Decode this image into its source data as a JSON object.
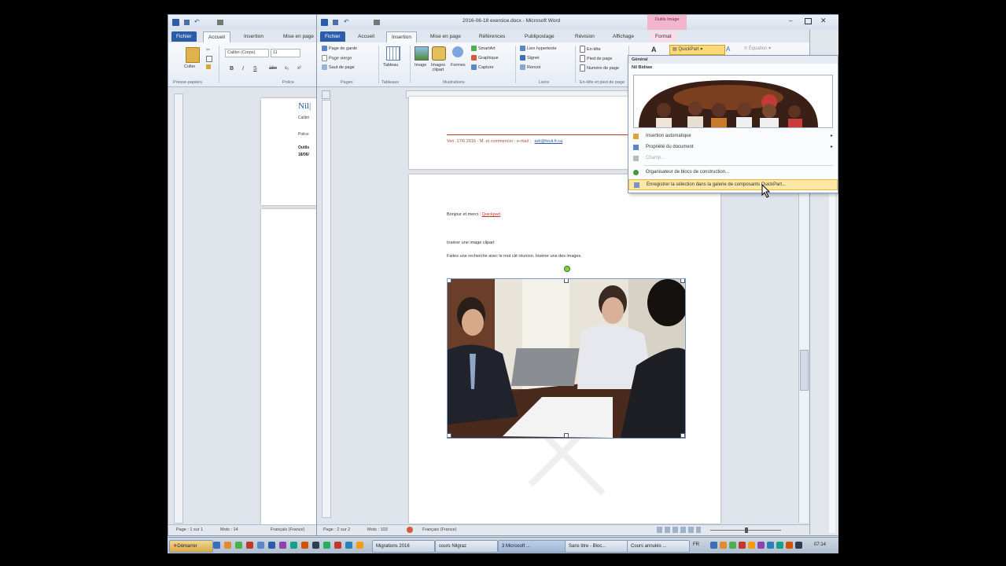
{
  "back_window": {
    "tabs": [
      "Fichier",
      "Accueil",
      "Insertion",
      "Mise en page"
    ],
    "font_name": "Calibri (Corps)",
    "font_size": "11",
    "paste_label": "Coller",
    "group_clipboard": "Presse-papiers",
    "group_font": "Police",
    "page_text": [
      "Nil|",
      "Calibri",
      "Police",
      "Outils",
      "18/06/"
    ],
    "status": [
      "Page : 1 sur 1",
      "Mots : 14",
      "Français (France)"
    ]
  },
  "front_window": {
    "title": "2016-06-18 exercice.docx - Microsoft Word",
    "context_tab": "Outils Image",
    "context_subtab": "Format",
    "tabs": [
      "Fichier",
      "Accueil",
      "Insertion",
      "Mise en page",
      "Références",
      "Publipostage",
      "Révision",
      "Affichage"
    ],
    "ribbon": {
      "pages": [
        "Page de garde",
        "Page vierge",
        "Saut de page"
      ],
      "group_pages": "Pages",
      "tableau": "Tableau",
      "group_tableaux": "Tableaux",
      "image": "Image",
      "images_clipart": "Images clipart",
      "formes": "Formes",
      "smartart": "SmartArt",
      "graphique": "Graphique",
      "capture": "Capture",
      "group_illustrations": "Illustrations",
      "lien_hypertexte": "Lien hypertexte",
      "signet": "Signet",
      "renvoi": "Renvoi",
      "group_liens": "Liens",
      "entete": "En-tête",
      "pied_de_page": "Pied de page",
      "numero_de_page": "Numéro de page",
      "group_entete": "En-tête et pied de page",
      "quickpart": "QuickPart",
      "equation": "Équation"
    },
    "page1_footer": "Ven. 17/6 2016 - M. et commencer : e-mail :",
    "page1_link": "adr@feuil.fr.ca",
    "page2_line1_prefix": "Bonjour et merci : ",
    "page2_line1_link": "Quickpart",
    "page2_line2": "Insérer une image clipart",
    "page2_line3": "Faites une recherche avec le mot clé réunion. Insérer une des images.",
    "status": [
      "Page : 2 sur 2",
      "Mots : 103",
      "Français (France)"
    ]
  },
  "quickpart_menu": {
    "header": "Général",
    "subheader": "Nil Bidiwe",
    "items": [
      {
        "label": "Insertion automatique",
        "arrow": true
      },
      {
        "label": "Propriété du document",
        "arrow": true
      },
      {
        "label": "Champ...",
        "arrow": false
      },
      {
        "label": "Organisateur de blocs de construction...",
        "arrow": false
      },
      {
        "label": "Enregistrer la sélection dans la galerie de composants QuickPart...",
        "arrow": false
      }
    ]
  },
  "taskbar": {
    "start": "Démarrer",
    "buttons": [
      "Migrations 2016",
      "cours Nilgraz",
      "3 Microsoft ...",
      "Sans titre - Bloc...",
      "Cours annulés ..."
    ],
    "lang": "FR",
    "clock": "07:14"
  }
}
